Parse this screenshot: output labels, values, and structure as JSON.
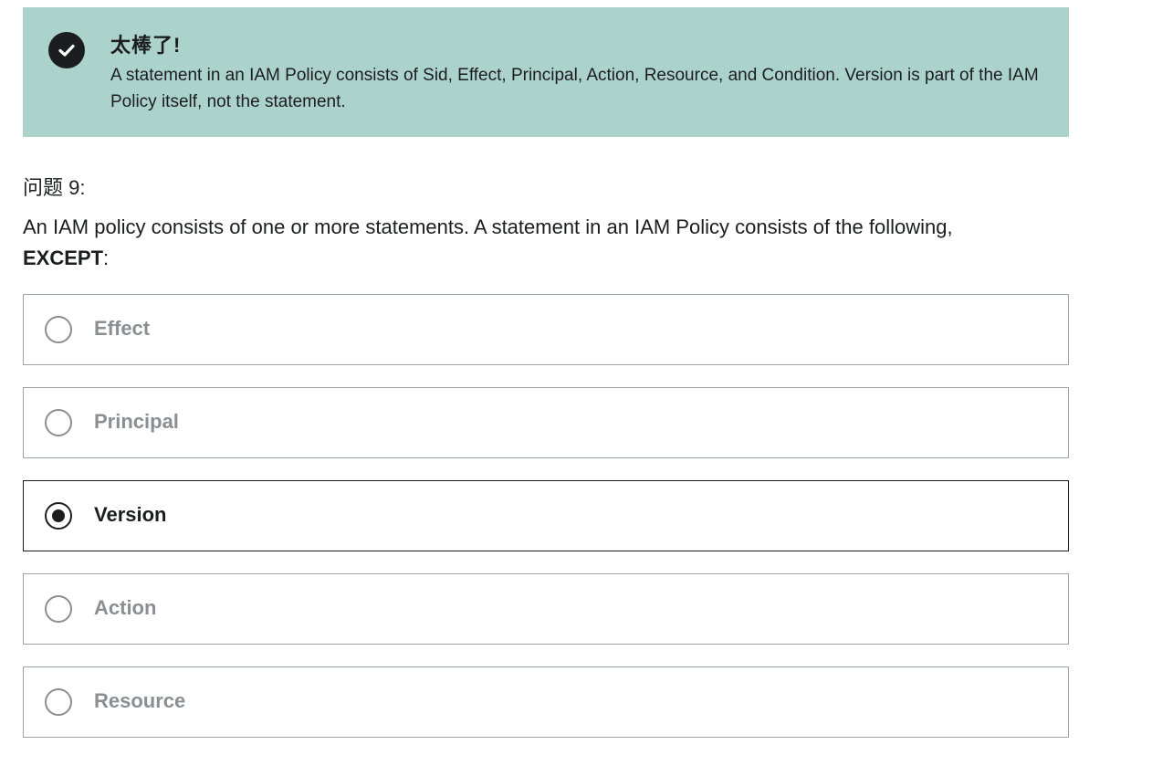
{
  "feedback": {
    "icon": "check-circle-icon",
    "title": "太棒了!",
    "message": "A statement in an IAM Policy consists of Sid, Effect, Principal, Action, Resource, and Condition. Version is part of the IAM Policy itself, not the statement.",
    "background_color": "#acd2cc"
  },
  "question": {
    "number_label": "问题 9:",
    "text": "An IAM policy consists of one or more statements. A statement in an IAM Policy consists of the following,",
    "emphasis": "EXCEPT",
    "suffix": ":"
  },
  "options": [
    {
      "label": "Effect",
      "selected": false
    },
    {
      "label": "Principal",
      "selected": false
    },
    {
      "label": "Version",
      "selected": true
    },
    {
      "label": "Action",
      "selected": false
    },
    {
      "label": "Resource",
      "selected": false
    }
  ]
}
